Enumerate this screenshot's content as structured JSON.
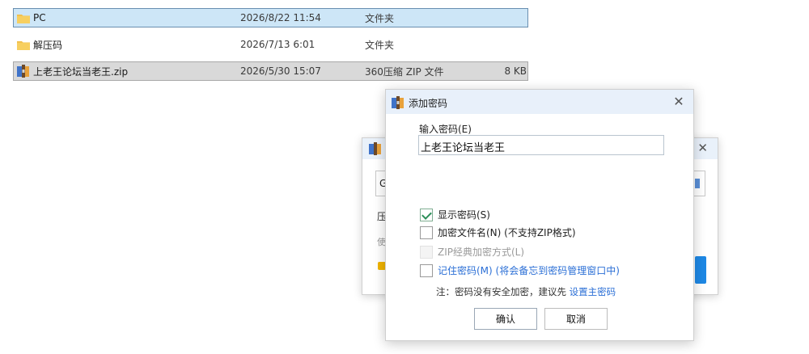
{
  "files": [
    {
      "name": "PC",
      "date": "2026/8/22 11:54",
      "type": "文件夹",
      "size": "",
      "icon": "folder-icon",
      "state": "selected"
    },
    {
      "name": "解压码",
      "date": "2026/7/13 6:01",
      "type": "文件夹",
      "size": "",
      "icon": "folder-icon",
      "state": "normal"
    },
    {
      "name": "上老王论坛当老王.zip",
      "date": "2026/5/30 15:07",
      "type": "360压缩 ZIP 文件",
      "size": "8 KB",
      "icon": "zip-archive-icon",
      "state": "highlighted"
    }
  ],
  "background_dialog": {
    "combo_value": "G",
    "label_1": "压",
    "label_2": "使",
    "close_glyph": "✕"
  },
  "password_dialog": {
    "title": "添加密码",
    "close_glyph": "✕",
    "input_label": "输入密码(E)",
    "input_value": "上老王论坛当老王",
    "options": {
      "show_password": {
        "label": "显示密码(S)",
        "checked": true
      },
      "encrypt_filenames": {
        "label": "加密文件名(N) (不支持ZIP格式)",
        "checked": false
      },
      "zip_classic": {
        "label": "ZIP经典加密方式(L)",
        "checked": false,
        "disabled": true
      },
      "remember_password": {
        "label": "记住密码(M) (将会备忘到密码管理窗口中)",
        "checked": false
      }
    },
    "note_text": "注：密码没有安全加密，建议先 ",
    "note_link": "设置主密码",
    "ok_label": "确认",
    "cancel_label": "取消"
  },
  "colors": {
    "selection": "#cde6f7",
    "titlebar": "#e8f0fa",
    "link": "#2b6fd6",
    "folder": "#f2c14e"
  }
}
